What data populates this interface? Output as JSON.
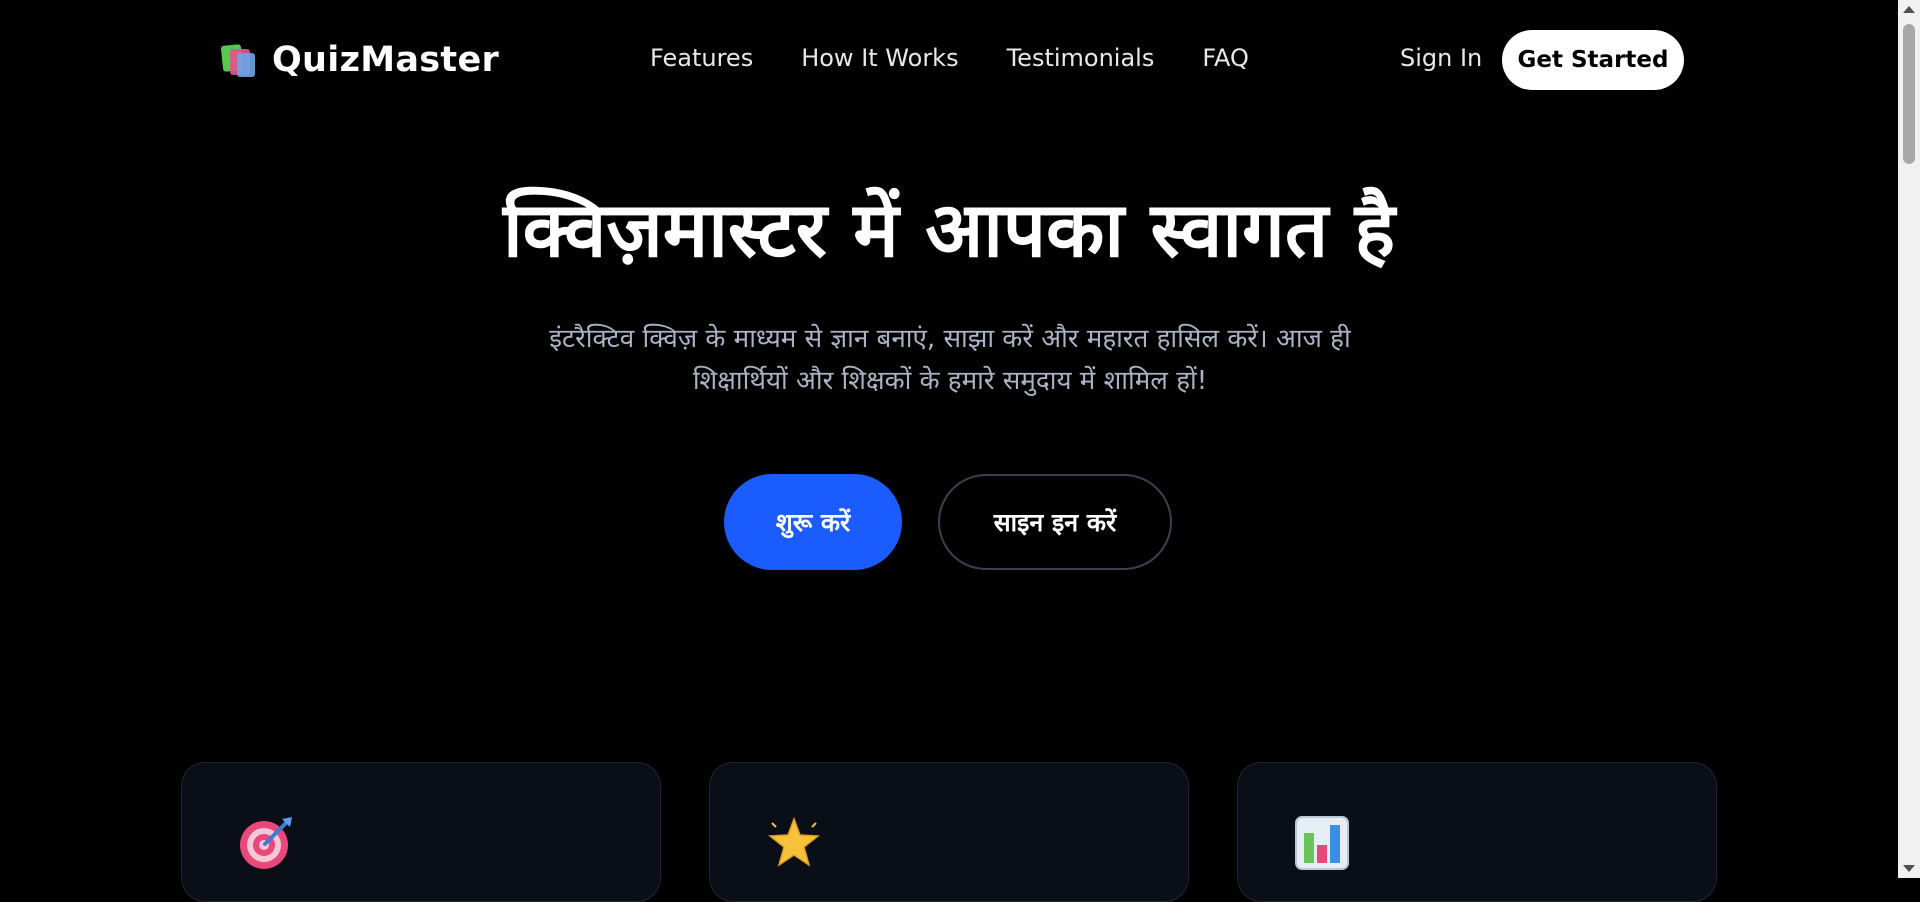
{
  "brand": {
    "name": "QuizMaster",
    "icon": "books-icon"
  },
  "nav": {
    "links": [
      "Features",
      "How It Works",
      "Testimonials",
      "FAQ"
    ],
    "sign_in": "Sign In",
    "get_started": "Get Started"
  },
  "hero": {
    "title": "क्विज़मास्टर में आपका स्वागत है",
    "subtitle_line1": "इंटरैक्टिव क्विज़ के माध्यम से ज्ञान बनाएं, साझा करें और महारत हासिल करें। आज ही",
    "subtitle_line2": "शिक्षार्थियों और शिक्षकों के हमारे समुदाय में शामिल हों!",
    "primary_cta": "शुरू करें",
    "secondary_cta": "साइन इन करें"
  },
  "feature_cards": [
    {
      "icon": "target-icon"
    },
    {
      "icon": "star-icon"
    },
    {
      "icon": "bar-chart-icon"
    }
  ],
  "colors": {
    "background": "#000000",
    "accent": "#1a5cff",
    "card_bg": "#0a0e17",
    "muted_text": "#aab3c5"
  }
}
